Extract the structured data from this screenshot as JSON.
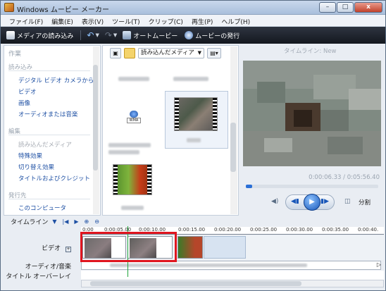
{
  "window": {
    "title": "Windows ムービー メーカー"
  },
  "titlebar": {
    "minimize": "–",
    "maximize": "□",
    "close": "x"
  },
  "menu": [
    "ファイル(F)",
    "編集(E)",
    "表示(V)",
    "ツール(T)",
    "クリップ(C)",
    "再生(P)",
    "ヘルプ(H)"
  ],
  "toolbar": {
    "import_label": "メディアの読み込み",
    "automovie_label": "オートムービー",
    "publish_label": "ムービーの発行"
  },
  "tasks": {
    "header": "作業",
    "sections": [
      {
        "title": "読み込み",
        "links": [
          "デジタル ビデオ カメラから",
          "ビデオ",
          "画像",
          "オーディオまたは音楽"
        ]
      },
      {
        "title": "編集",
        "links": [
          "読み込んだメディア",
          "特殊効果",
          "切り替え効果",
          "タイトルおよびクレジット"
        ]
      },
      {
        "title": "発行先",
        "links": [
          "このコンピュータ"
        ]
      }
    ]
  },
  "collection": {
    "dropdown": "読み込んだメディア",
    "wma_label": "WMA"
  },
  "preview": {
    "title": "タイムライン: New",
    "time": "0:00:06.33 / 0:05:56.40",
    "split_label": "分割"
  },
  "timeline": {
    "label": "タイムライン",
    "ticks": [
      "0:00",
      "0:00:05.00",
      "0:00:10.00",
      "0:00:15.00",
      "0:00:20.00",
      "0:00:25.00",
      "0:00:30.00",
      "0:00:35.00",
      "0:00:40."
    ],
    "tracks": {
      "video": "ビデオ",
      "audio": "オーディオ/音楽",
      "overlay": "タイトル オーバーレイ"
    }
  },
  "colors": {
    "accent": "#1d4fa3",
    "highlight": "#e0151f",
    "toolbar_bg": "#1f242d"
  }
}
